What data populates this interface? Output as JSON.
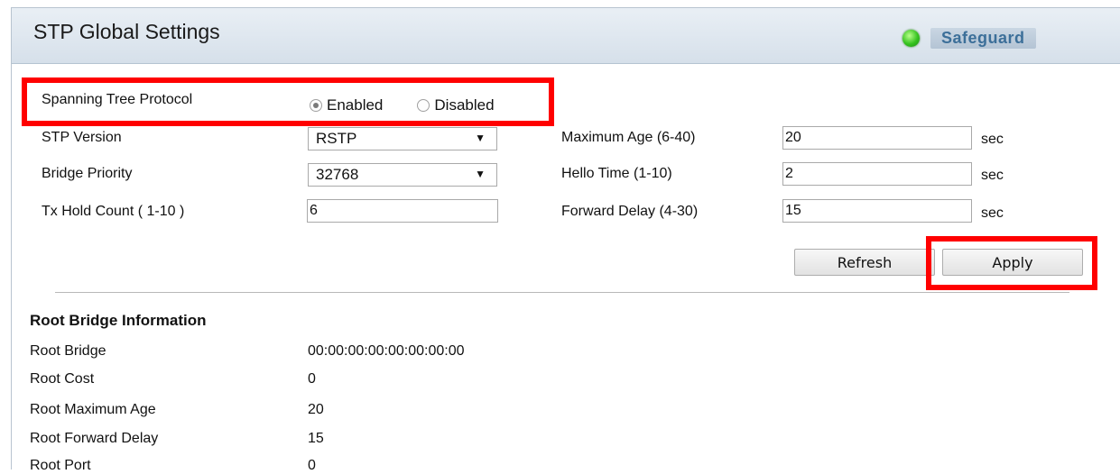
{
  "header": {
    "title": "STP Global Settings",
    "safeguard_label": "Safeguard",
    "status_icon": "green-status-led",
    "status_color": "#35c21f"
  },
  "spanning_tree": {
    "label": "Spanning Tree Protocol",
    "options": [
      "Enabled",
      "Disabled"
    ],
    "selected": "Enabled"
  },
  "settings_left": {
    "stp_version_label": "STP Version",
    "stp_version_value": "RSTP",
    "bridge_priority_label": "Bridge Priority",
    "bridge_priority_value": "32768",
    "tx_hold_count_label": "Tx Hold Count ( 1-10 )",
    "tx_hold_count_value": "6"
  },
  "settings_right": {
    "max_age_label": "Maximum Age (6-40)",
    "max_age_value": "20",
    "hello_time_label": "Hello Time (1-10)",
    "hello_time_value": "2",
    "forward_delay_label": "Forward Delay (4-30)",
    "forward_delay_value": "15",
    "unit": "sec"
  },
  "buttons": {
    "refresh": "Refresh",
    "apply": "Apply"
  },
  "root_bridge": {
    "title": "Root Bridge Information",
    "rows": [
      {
        "label": "Root Bridge",
        "value": "00:00:00:00:00:00:00:00"
      },
      {
        "label": "Root Cost",
        "value": "0"
      },
      {
        "label": "Root Maximum Age",
        "value": "20"
      },
      {
        "label": "Root Forward Delay",
        "value": "15"
      },
      {
        "label": "Root Port",
        "value": "0"
      }
    ]
  },
  "highlight_color": "#ff0000"
}
